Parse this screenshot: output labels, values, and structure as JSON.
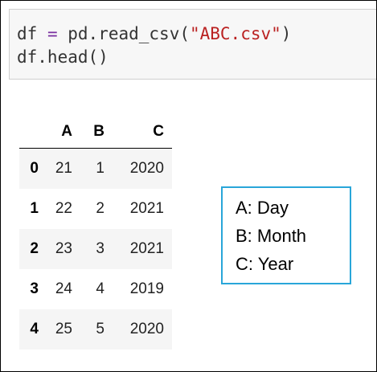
{
  "code_cell": {
    "line1": {
      "target": "df",
      "op": "=",
      "call": "pd.read_csv(",
      "arg": "\"ABC.csv\"",
      "close": ")"
    },
    "line2": "df.head()"
  },
  "dataframe": {
    "columns": [
      "A",
      "B",
      "C"
    ],
    "rows": [
      {
        "index": "0",
        "A": "21",
        "B": "1",
        "C": "2020"
      },
      {
        "index": "1",
        "A": "22",
        "B": "2",
        "C": "2021"
      },
      {
        "index": "2",
        "A": "23",
        "B": "3",
        "C": "2021"
      },
      {
        "index": "3",
        "A": "24",
        "B": "4",
        "C": "2019"
      },
      {
        "index": "4",
        "A": "25",
        "B": "5",
        "C": "2020"
      }
    ]
  },
  "legend": {
    "items": [
      "A: Day",
      "B: Month",
      "C: Year"
    ],
    "border_color": "#29a6d9"
  }
}
